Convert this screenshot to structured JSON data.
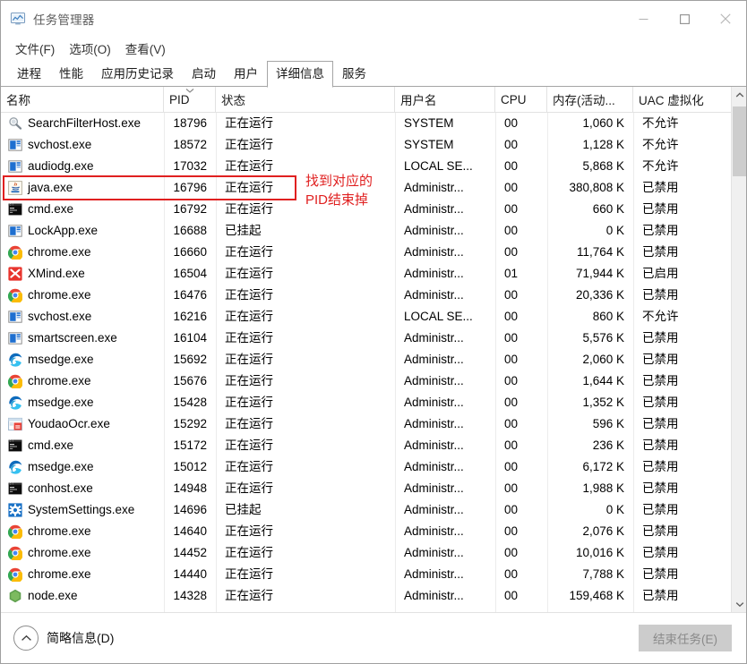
{
  "window": {
    "title": "任务管理器",
    "icon": "task-manager-icon",
    "controls": {
      "minimize": "minimize-icon",
      "maximize": "maximize-icon",
      "close": "close-icon"
    }
  },
  "menu": {
    "items": [
      {
        "label": "文件(F)"
      },
      {
        "label": "选项(O)"
      },
      {
        "label": "查看(V)"
      }
    ]
  },
  "tabs": {
    "items": [
      {
        "label": "进程",
        "active": false
      },
      {
        "label": "性能",
        "active": false
      },
      {
        "label": "应用历史记录",
        "active": false
      },
      {
        "label": "启动",
        "active": false
      },
      {
        "label": "用户",
        "active": false
      },
      {
        "label": "详细信息",
        "active": true
      },
      {
        "label": "服务",
        "active": false
      }
    ]
  },
  "table": {
    "columns": [
      {
        "key": "name",
        "label": "名称",
        "sort": ""
      },
      {
        "key": "pid",
        "label": "PID",
        "sort": "descending"
      },
      {
        "key": "status",
        "label": "状态",
        "sort": ""
      },
      {
        "key": "user",
        "label": "用户名",
        "sort": ""
      },
      {
        "key": "cpu",
        "label": "CPU",
        "sort": ""
      },
      {
        "key": "mem",
        "label": "内存(活动...",
        "sort": ""
      },
      {
        "key": "uac",
        "label": "UAC 虚拟化",
        "sort": ""
      }
    ],
    "rows": [
      {
        "icon": "search-filter-host-icon",
        "name": "SearchFilterHost.exe",
        "pid": "18796",
        "status": "正在运行",
        "user": "SYSTEM",
        "cpu": "00",
        "mem": "1,060 K",
        "uac": "不允许"
      },
      {
        "icon": "generic-app-icon",
        "name": "svchost.exe",
        "pid": "18572",
        "status": "正在运行",
        "user": "SYSTEM",
        "cpu": "00",
        "mem": "1,128 K",
        "uac": "不允许"
      },
      {
        "icon": "generic-app-icon",
        "name": "audiodg.exe",
        "pid": "17032",
        "status": "正在运行",
        "user": "LOCAL SE...",
        "cpu": "00",
        "mem": "5,868 K",
        "uac": "不允许"
      },
      {
        "icon": "java-icon",
        "name": "java.exe",
        "pid": "16796",
        "status": "正在运行",
        "user": "Administr...",
        "cpu": "00",
        "mem": "380,808 K",
        "uac": "已禁用"
      },
      {
        "icon": "console-icon",
        "name": "cmd.exe",
        "pid": "16792",
        "status": "正在运行",
        "user": "Administr...",
        "cpu": "00",
        "mem": "660 K",
        "uac": "已禁用"
      },
      {
        "icon": "generic-app-icon",
        "name": "LockApp.exe",
        "pid": "16688",
        "status": "已挂起",
        "user": "Administr...",
        "cpu": "00",
        "mem": "0 K",
        "uac": "已禁用"
      },
      {
        "icon": "chrome-icon",
        "name": "chrome.exe",
        "pid": "16660",
        "status": "正在运行",
        "user": "Administr...",
        "cpu": "00",
        "mem": "11,764 K",
        "uac": "已禁用"
      },
      {
        "icon": "xmind-icon",
        "name": "XMind.exe",
        "pid": "16504",
        "status": "正在运行",
        "user": "Administr...",
        "cpu": "01",
        "mem": "71,944 K",
        "uac": "已启用"
      },
      {
        "icon": "chrome-icon",
        "name": "chrome.exe",
        "pid": "16476",
        "status": "正在运行",
        "user": "Administr...",
        "cpu": "00",
        "mem": "20,336 K",
        "uac": "已禁用"
      },
      {
        "icon": "generic-app-icon",
        "name": "svchost.exe",
        "pid": "16216",
        "status": "正在运行",
        "user": "LOCAL SE...",
        "cpu": "00",
        "mem": "860 K",
        "uac": "不允许"
      },
      {
        "icon": "generic-app-icon",
        "name": "smartscreen.exe",
        "pid": "16104",
        "status": "正在运行",
        "user": "Administr...",
        "cpu": "00",
        "mem": "5,576 K",
        "uac": "已禁用"
      },
      {
        "icon": "edge-icon",
        "name": "msedge.exe",
        "pid": "15692",
        "status": "正在运行",
        "user": "Administr...",
        "cpu": "00",
        "mem": "2,060 K",
        "uac": "已禁用"
      },
      {
        "icon": "chrome-icon",
        "name": "chrome.exe",
        "pid": "15676",
        "status": "正在运行",
        "user": "Administr...",
        "cpu": "00",
        "mem": "1,644 K",
        "uac": "已禁用"
      },
      {
        "icon": "edge-icon",
        "name": "msedge.exe",
        "pid": "15428",
        "status": "正在运行",
        "user": "Administr...",
        "cpu": "00",
        "mem": "1,352 K",
        "uac": "已禁用"
      },
      {
        "icon": "youdao-ocr-icon",
        "name": "YoudaoOcr.exe",
        "pid": "15292",
        "status": "正在运行",
        "user": "Administr...",
        "cpu": "00",
        "mem": "596 K",
        "uac": "已禁用"
      },
      {
        "icon": "console-icon",
        "name": "cmd.exe",
        "pid": "15172",
        "status": "正在运行",
        "user": "Administr...",
        "cpu": "00",
        "mem": "236 K",
        "uac": "已禁用"
      },
      {
        "icon": "edge-icon",
        "name": "msedge.exe",
        "pid": "15012",
        "status": "正在运行",
        "user": "Administr...",
        "cpu": "00",
        "mem": "6,172 K",
        "uac": "已禁用"
      },
      {
        "icon": "console-icon",
        "name": "conhost.exe",
        "pid": "14948",
        "status": "正在运行",
        "user": "Administr...",
        "cpu": "00",
        "mem": "1,988 K",
        "uac": "已禁用"
      },
      {
        "icon": "settings-gear-icon",
        "name": "SystemSettings.exe",
        "pid": "14696",
        "status": "已挂起",
        "user": "Administr...",
        "cpu": "00",
        "mem": "0 K",
        "uac": "已禁用"
      },
      {
        "icon": "chrome-icon",
        "name": "chrome.exe",
        "pid": "14640",
        "status": "正在运行",
        "user": "Administr...",
        "cpu": "00",
        "mem": "2,076 K",
        "uac": "已禁用"
      },
      {
        "icon": "chrome-icon",
        "name": "chrome.exe",
        "pid": "14452",
        "status": "正在运行",
        "user": "Administr...",
        "cpu": "00",
        "mem": "10,016 K",
        "uac": "已禁用"
      },
      {
        "icon": "chrome-icon",
        "name": "chrome.exe",
        "pid": "14440",
        "status": "正在运行",
        "user": "Administr...",
        "cpu": "00",
        "mem": "7,788 K",
        "uac": "已禁用"
      },
      {
        "icon": "nodejs-icon",
        "name": "node.exe",
        "pid": "14328",
        "status": "正在运行",
        "user": "Administr...",
        "cpu": "00",
        "mem": "159,468 K",
        "uac": "已禁用"
      }
    ]
  },
  "annotation": {
    "color": "#e02020",
    "line1": "找到对应的",
    "line2": "PID结束掉",
    "highlighted_row_pid": "16796"
  },
  "scrollbar": {
    "up_arrow": "chevron-up-icon",
    "down_arrow": "chevron-down-icon"
  },
  "footer": {
    "fewer_details_label": "简略信息(D)",
    "fewer_details_icon": "chevron-up-circle-icon",
    "end_task_label": "结束任务(E)",
    "end_task_disabled": true
  }
}
